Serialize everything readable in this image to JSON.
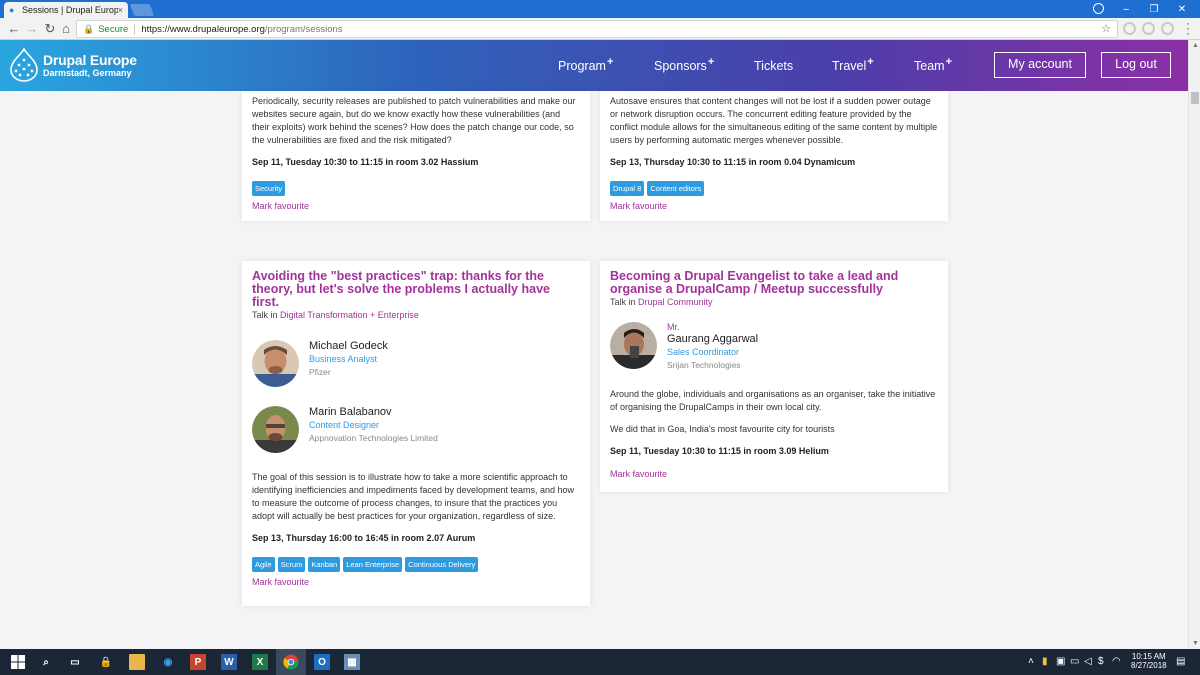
{
  "browser": {
    "tab_title": "Sessions | Drupal Europe",
    "tab_close": "×",
    "secure_label": "Secure",
    "url_host": "https://www.drupaleurope.org",
    "url_path": "/program/sessions"
  },
  "header": {
    "logo_name": "Drupal Europe",
    "logo_sub": "Darmstadt, Germany",
    "nav": [
      "Program",
      "Sponsors",
      "Tickets",
      "Travel",
      "Team"
    ],
    "nav_plus": "+",
    "my_account": "My account",
    "log_out": "Log out",
    "gradient_colors": [
      "#2aa6df",
      "#2e63bb",
      "#4b3fa9",
      "#8b2fa6"
    ]
  },
  "sessions": [
    {
      "description": "Periodically, security releases are published to patch vulnerabilities and make our websites secure again, but do we know exactly how these vulnerabilities (and their exploits) work behind the scenes? How does the patch change our code, so the vulnerabilities are fixed and the risk mitigated?",
      "when": "Sep 11, Tuesday 10:30 to 11:15 in room 3.02 Hassium",
      "tags": [
        "Security"
      ],
      "favourite": "Mark favourite"
    },
    {
      "description": "Autosave ensures that content changes will not be lost if a sudden power outage or network disruption occurs. The concurrent editing feature provided by the conflict module allows for the simultaneous editing of the same content by multiple users by performing automatic merges whenever possible.",
      "when": "Sep 13, Thursday 10:30 to 11:15 in room 0.04 Dynamicum",
      "tags": [
        "Drupal 8",
        "Content editors"
      ],
      "favourite": "Mark favourite"
    },
    {
      "title": "Avoiding the \"best practices\" trap: thanks for the theory, but let's solve the problems I actually have first.",
      "talk_prefix": "Talk in ",
      "track": "Digital Transformation + Enterprise",
      "speakers": [
        {
          "name": "Michael Godeck",
          "role": "Business Analyst",
          "org": "Pfizer"
        },
        {
          "name": "Marin Balabanov",
          "role": "Content Designer",
          "org": "Appnovation Technologies Limited"
        }
      ],
      "description": "The goal of this session is to illustrate how to take a more scientific approach to identifying inefficiencies and impediments faced by development teams, and how to measure the outcome of process changes, to insure that the practices you adopt will actually be best practices for your organization, regardless of size.",
      "when": "Sep 13, Thursday 16:00 to 16:45 in room 2.07 Aurum",
      "tags": [
        "Agile",
        "Scrum",
        "Kanban",
        "Lean Enterprise",
        "Continuous Delivery"
      ],
      "favourite": "Mark favourite"
    },
    {
      "title": "Becoming a Drupal Evangelist to take a lead and organise a DrupalCamp / Meetup successfully",
      "talk_prefix": "Talk in ",
      "track": "Drupal Community",
      "speakers": [
        {
          "prefix": "Mr.",
          "name": "Gaurang Aggarwal",
          "role": "Sales Coordinator",
          "org": "Srijan Technologies"
        }
      ],
      "description": "Around the globe, individuals and organisations as an organiser, take the initiative of organising the DrupalCamps in their own local city.",
      "description2": "We did that in Goa, India's most favourite city for tourists",
      "when": "Sep 11, Tuesday 10:30 to 11:15 in room 3.09 Helium",
      "favourite": "Mark favourite"
    }
  ],
  "taskbar": {
    "time": "10:15 AM",
    "date": "8/27/2018"
  },
  "colors": {
    "accent": "#a3339a",
    "tag": "#2e9be0",
    "taskbar": "#1b2736"
  }
}
